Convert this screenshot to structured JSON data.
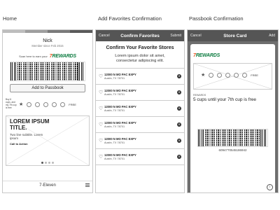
{
  "colors": {
    "nav_bg": "#555555",
    "logo_orange": "#e8541c",
    "logo_green": "#0a7a3e",
    "statusbar": [
      "#bdbdbd",
      "#9e9e9e",
      "#7a7a7a",
      "#5a5a5a"
    ]
  },
  "panels": {
    "home": {
      "caption": "Home",
      "name": "Nick",
      "member": "Member since Feb 2015",
      "scan_text": "Scan here to earn your",
      "logo": {
        "number": "7",
        "text": "REWARDS"
      },
      "add_passbook": "Add to Passbook",
      "cups_note": "Buy 6 cups, and my 7th cup is free",
      "free": "FREE",
      "promo": {
        "title": "LOREM IPSUM TITLE.",
        "subtitle": "Two line subtitle. Lorem ipsum",
        "cta": "Call to Action"
      },
      "footer": "7-Eleven",
      "icons": {
        "star": "star-icon",
        "menu": "menu-icon"
      }
    },
    "confirm": {
      "caption": "Add Favorites Confirmation",
      "nav": {
        "left": "Cancel",
        "title": "Confirm Favorites",
        "right": "Submit"
      },
      "heading": "Confirm Your Favorite Stores",
      "body": "Lorem ipsum dolor sit amet, consectetur adipiscing elit.",
      "stores": [
        {
          "addr": "12000 N MO PAC EXPY",
          "city": "Austin, TX 78701"
        },
        {
          "addr": "12000 N MO PAC EXPY",
          "city": "Austin, TX 78701"
        },
        {
          "addr": "12000 N MO PAC EXPY",
          "city": "Austin, TX 78701"
        },
        {
          "addr": "12000 N MO PAC EXPY",
          "city": "Austin, TX 78701"
        },
        {
          "addr": "12000 N MO PAC EXPY",
          "city": "Austin, TX 78701"
        },
        {
          "addr": "12000 N MO PAC EXPY",
          "city": "Austin, TX 78701"
        }
      ],
      "icons": {
        "heart": "heart-icon",
        "remove": "remove-icon"
      }
    },
    "passbook": {
      "caption": "Passbook Confirmation",
      "nav": {
        "left": "Cancel",
        "title": "Store Card",
        "right": "Add"
      },
      "logo": {
        "number": "7",
        "text": "REWARDS"
      },
      "free": "FREE",
      "rewards_label": "REWARDS",
      "rewards_text": "5 cups until your 7th cup is free",
      "card_number": "6094770545186942",
      "icons": {
        "info": "info-icon"
      }
    }
  }
}
